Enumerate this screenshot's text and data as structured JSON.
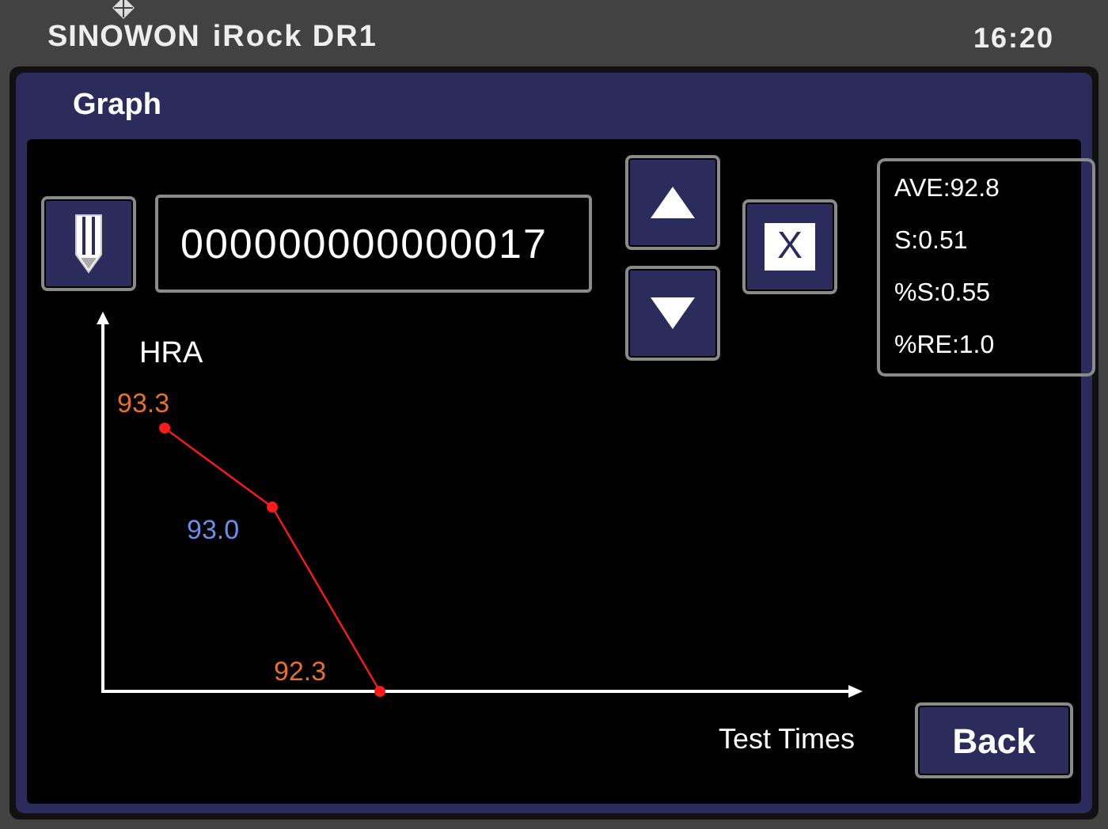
{
  "header": {
    "logo": "SINOWON",
    "model": "iRock DR1",
    "time": "16:20"
  },
  "screen": {
    "title": "Graph"
  },
  "sample_id": {
    "value": "000000000000017"
  },
  "clear_button": {
    "label": "X"
  },
  "stats": [
    "AVE:92.8",
    "S:0.51",
    "%S:0.55",
    "%RE:1.0"
  ],
  "chart_data": {
    "type": "line",
    "ylabel": "HRA",
    "ylim": [
      92.3,
      93.7
    ],
    "data_labels": true,
    "annotations": [
      {
        "text": "Test Times"
      }
    ],
    "series": [
      {
        "color": "#ff1a1a",
        "marker": "circle",
        "values": [
          93.3,
          93.0,
          92.3
        ],
        "value_labels": [
          "93.3",
          "93.0",
          "92.3"
        ]
      }
    ]
  },
  "back_button": {
    "label": "Back"
  }
}
